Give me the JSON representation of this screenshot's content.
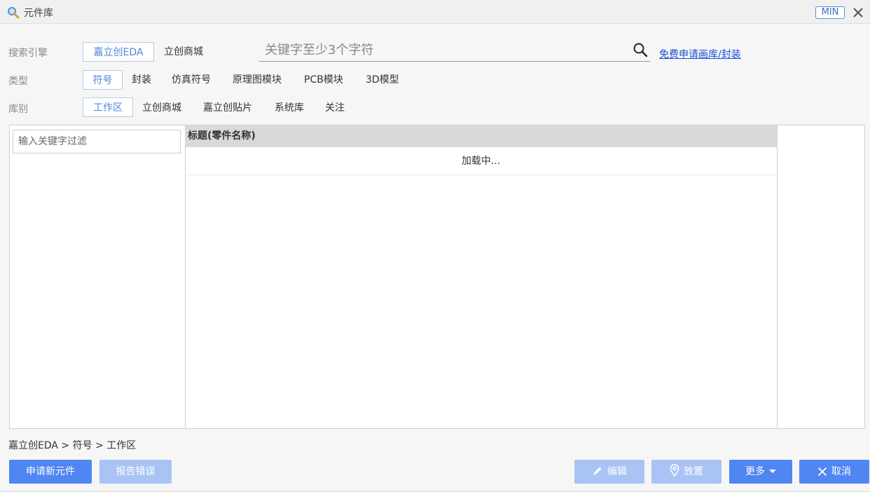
{
  "window": {
    "title": "元件库",
    "min_label": "MIN"
  },
  "filters": {
    "engine": {
      "label": "搜索引擎",
      "options": [
        "嘉立创EDA",
        "立创商城"
      ],
      "selected": "嘉立创EDA"
    },
    "type": {
      "label": "类型",
      "options": [
        "符号",
        "封装",
        "仿真符号",
        "原理图模块",
        "PCB模块",
        "3D模型"
      ],
      "selected": "符号"
    },
    "library": {
      "label": "库别",
      "options": [
        "工作区",
        "立创商城",
        "嘉立创贴片",
        "系统库",
        "关注"
      ],
      "selected": "工作区"
    }
  },
  "search": {
    "placeholder": "关键字至少3个字符",
    "value": "",
    "apply_link": "免费申请画库/封装"
  },
  "left_pane": {
    "filter_placeholder": "输入关键字过滤"
  },
  "table": {
    "header": "标题(零件名称)",
    "loading_text": "加载中..."
  },
  "breadcrumb": "嘉立创EDA > 符号 > 工作区",
  "buttons": {
    "apply_new": "申请新元件",
    "report_error": "报告错误",
    "edit": "编辑",
    "place": "放置",
    "more": "更多",
    "cancel": "取消"
  },
  "colors": {
    "accent": "#4f86f2",
    "accent_disabled": "#a9c3f5",
    "selected_text": "#4f86d6",
    "link": "#1a4fd8"
  }
}
